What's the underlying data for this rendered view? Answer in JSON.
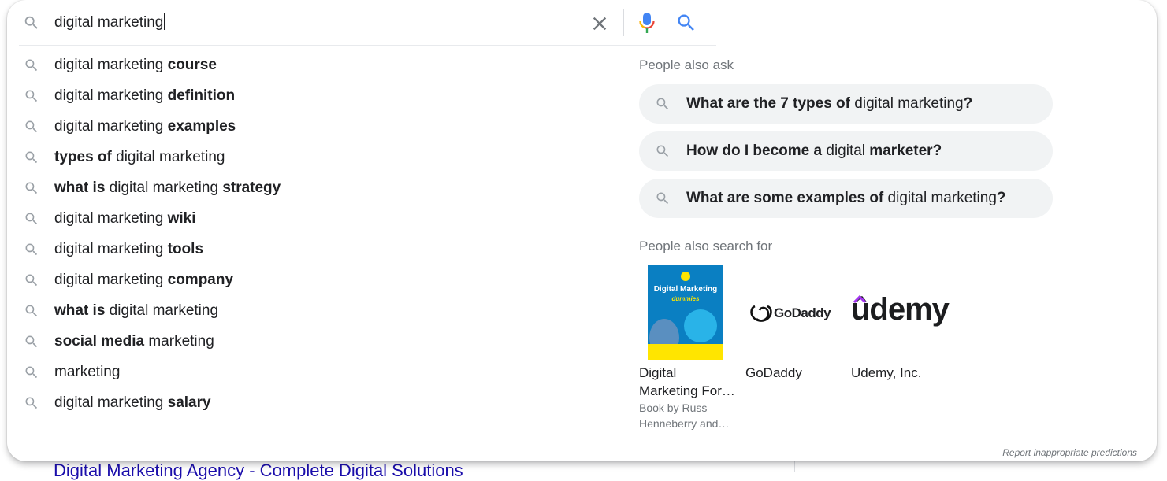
{
  "search": {
    "query": "digital marketing"
  },
  "suggestions": [
    {
      "normal_before": "digital marketing ",
      "bold": "course",
      "normal_after": ""
    },
    {
      "normal_before": "digital marketing ",
      "bold": "definition",
      "normal_after": ""
    },
    {
      "normal_before": "digital marketing ",
      "bold": "examples",
      "normal_after": ""
    },
    {
      "bold_before": "types of",
      "normal": " digital marketing",
      "bold_after": ""
    },
    {
      "bold_before": "what is",
      "normal": " digital marketing ",
      "bold_after": "strategy"
    },
    {
      "normal_before": "digital marketing ",
      "bold": "wiki",
      "normal_after": ""
    },
    {
      "normal_before": "digital marketing ",
      "bold": "tools",
      "normal_after": ""
    },
    {
      "normal_before": "digital marketing ",
      "bold": "company",
      "normal_after": ""
    },
    {
      "bold_before": "what is",
      "normal": " digital marketing",
      "bold_after": ""
    },
    {
      "bold_before": "social media",
      "normal": " marketing",
      "bold_after": ""
    },
    {
      "normal_before": "marketing",
      "bold": "",
      "normal_after": ""
    },
    {
      "normal_before": "digital marketing ",
      "bold": "salary",
      "normal_after": ""
    }
  ],
  "people_also_ask": {
    "title": "People also ask",
    "questions": [
      {
        "b1": "What are the 7 types of",
        "n1": " digital marketing",
        "b2": "?"
      },
      {
        "b1": "How do I become a",
        "n1": " digital ",
        "b2": "marketer?"
      },
      {
        "b1": "What are some examples of",
        "n1": " digital marketing",
        "b2": "?"
      }
    ]
  },
  "people_also_search_for": {
    "title": "People also search for",
    "items": [
      {
        "name_line1": "Digital",
        "name_line2": "Marketing For…",
        "sub_line1": "Book by Russ",
        "sub_line2": "Henneberry and…",
        "thumb_title": "Digital Marketing",
        "thumb_subtitle": "dummies"
      },
      {
        "name_line1": "GoDaddy",
        "logo_text": "GoDaddy"
      },
      {
        "name_line1": "Udemy, Inc.",
        "logo_text": "ûdemy"
      }
    ]
  },
  "footer": {
    "report": "Report inappropriate predictions"
  },
  "background": {
    "result_link": "Digital Marketing Agency - Complete Digital Solutions"
  },
  "colors": {
    "accent_blue": "#4285f4",
    "link": "#1a0dab",
    "muted": "#70757a"
  },
  "icons": [
    "search-icon",
    "clear-icon",
    "mic-icon",
    "search-button-icon"
  ]
}
